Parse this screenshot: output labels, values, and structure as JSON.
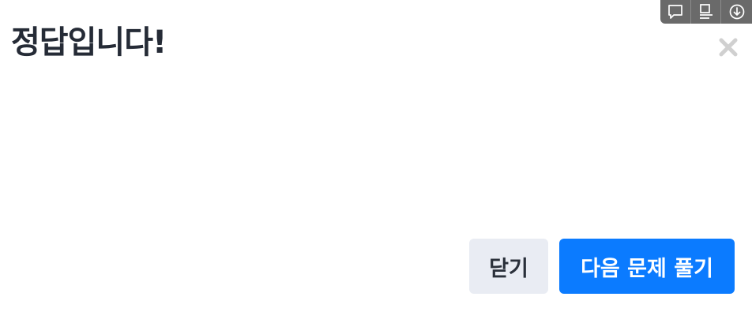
{
  "modal": {
    "title": "정답입니다!",
    "close_icon": "close-icon"
  },
  "footer": {
    "close_label": "닫기",
    "next_label": "다음 문제 풀기"
  },
  "overlay_toolbar": {
    "icons": [
      "comment-icon",
      "notes-icon",
      "download-icon"
    ]
  },
  "colors": {
    "title": "#252b36",
    "primary": "#0b7bff",
    "secondary_bg": "#e9ecf3",
    "close_icon": "#d0d0d0",
    "toolbar_bg": "#6a6a6a"
  }
}
